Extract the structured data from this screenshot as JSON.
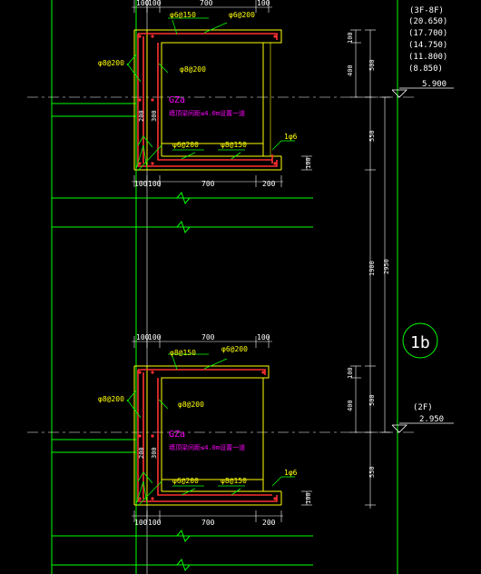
{
  "colors": {
    "background": "#000000",
    "dim": "#ffffff",
    "grid": "#00ff00",
    "concrete": "#ffff00",
    "rebar": "#ff3030",
    "note": "#ff00ff",
    "steel_label": "#ffff00",
    "axis_line": "#ffffff"
  },
  "upper_section": {
    "top_dims": [
      "100",
      "100",
      "700",
      "100"
    ],
    "rebar_top_1": "φ6@150",
    "rebar_top_2": "φ6@200",
    "rebar_left": "φ8@200",
    "rebar_mid": "φ8@200",
    "col_label": "GZa",
    "note": "墙顶梁间距≤4.0m设置一道",
    "col_dim_a": "200",
    "col_dim_b": "300",
    "rebar_bot_1": "φ6@200",
    "rebar_bot_2": "φ8@150",
    "bottom_label": "1φ6",
    "bottom_dims": [
      "100",
      "100",
      "700",
      "200"
    ],
    "right_dims": [
      "100",
      "400",
      "100"
    ]
  },
  "lower_section": {
    "top_dims": [
      "100",
      "100",
      "700",
      "100"
    ],
    "rebar_top_1": "φ8@150",
    "rebar_top_2": "φ6@200",
    "rebar_left": "φ8@200",
    "rebar_mid": "φ8@200",
    "col_label": "GZa",
    "note": "墙顶梁间距≤4.0m设置一道",
    "col_dim_a": "200",
    "col_dim_b": "300",
    "rebar_bot_1": "φ6@200",
    "rebar_bot_2": "φ8@150",
    "bottom_label": "1φ6",
    "bottom_dims": [
      "100",
      "100",
      "700",
      "200"
    ],
    "right_dims": [
      "100",
      "400",
      "100"
    ]
  },
  "elevation_dims": {
    "d500_top": "500",
    "d550_top": "550",
    "d1900": "1900",
    "d2950": "2950",
    "d500_bot": "500",
    "d550_bot": "550"
  },
  "levels": {
    "floors_upper": "(3F-8F)",
    "elev_list": [
      "(20.650)",
      "(17.700)",
      "(14.750)",
      "(11.800)",
      "(8.850)"
    ],
    "elev_upper": "5.900",
    "floor_lower": "(2F)",
    "elev_lower": "2.950"
  },
  "axis_bubble": "1b"
}
